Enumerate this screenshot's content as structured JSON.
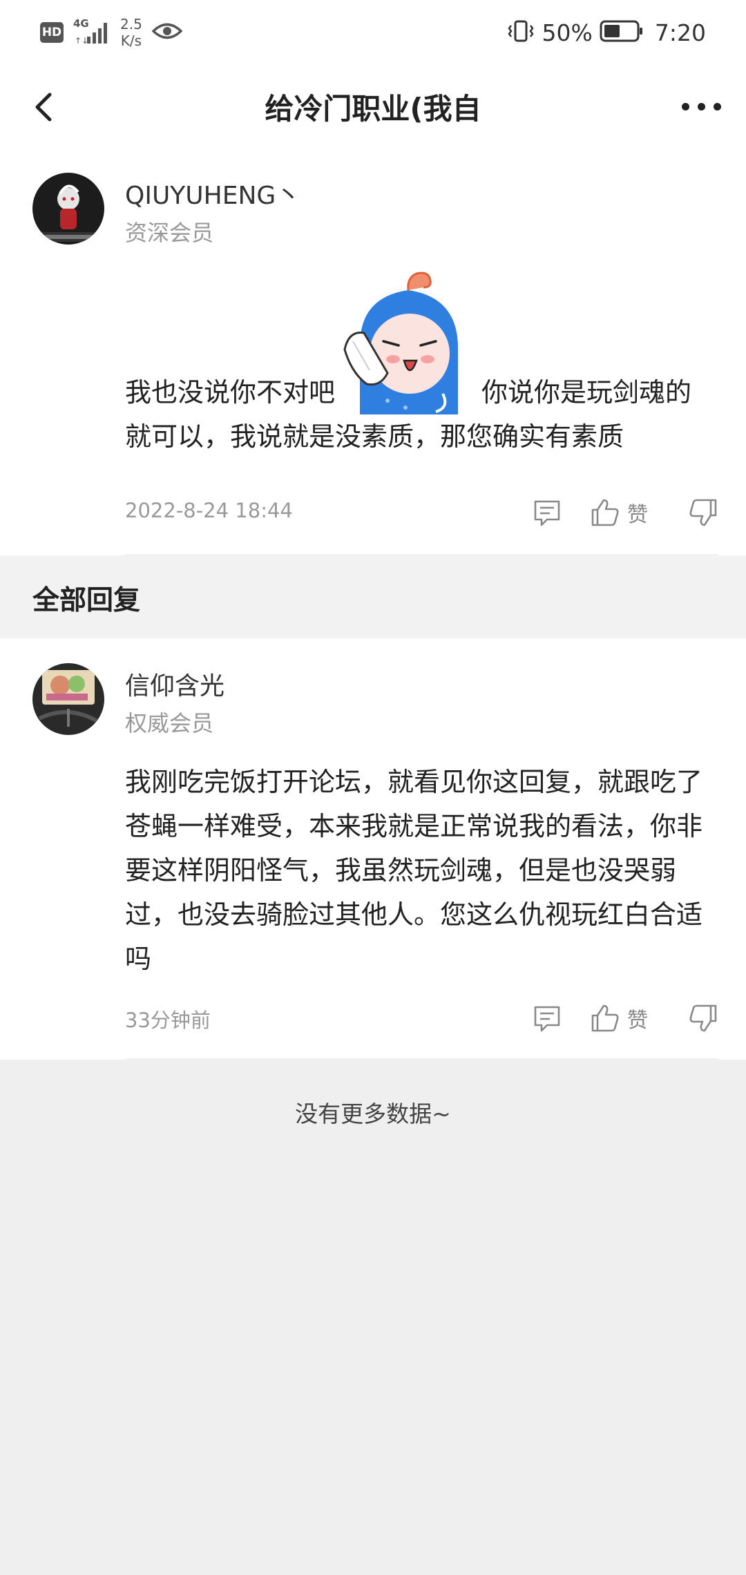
{
  "status_bar": {
    "hd": "HD",
    "network": "4G",
    "speed_value": "2.5",
    "speed_unit": "K/s",
    "battery": "50%",
    "time": "7:20"
  },
  "nav": {
    "title": "给冷门职业(我自"
  },
  "post": {
    "username": "QIUYUHENG丶",
    "member_level": "资深会员",
    "text_before": "我也没说你不对吧",
    "text_after": "你说你是玩剑魂的就可以，我说就是没素质，那您确实有素质",
    "time": "2022-8-24 18:44",
    "like_label": "赞"
  },
  "replies_section": {
    "title": "全部回复"
  },
  "replies": [
    {
      "username": "信仰含光",
      "member_level": "权威会员",
      "text": "我刚吃完饭打开论坛，就看见你这回复，就跟吃了苍蝇一样难受，本来我就是正常说我的看法，你非要这样阴阳怪气，我虽然玩剑魂，但是也没哭弱过，也没去骑脸过其他人。您这么仇视玩红白合适吗",
      "time": "33分钟前",
      "like_label": "赞"
    }
  ],
  "footer": {
    "no_more": "没有更多数据~"
  },
  "colors": {
    "background": "#efefef",
    "section": "#f2f2f2",
    "muted_text": "#999999",
    "sticker_blue": "#2f7fe0"
  }
}
